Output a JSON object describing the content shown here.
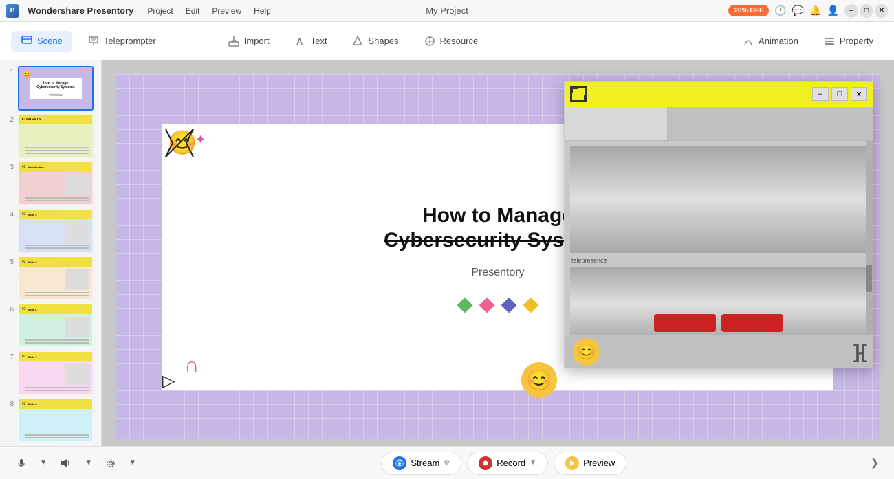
{
  "app": {
    "name": "Wondershare Presentory",
    "title": "My Project",
    "promo": "20% OFF"
  },
  "menu": {
    "items": [
      "Project",
      "Edit",
      "Preview",
      "Help"
    ]
  },
  "toolbar": {
    "items": [
      {
        "id": "scene",
        "label": "Scene",
        "icon": "scene-icon"
      },
      {
        "id": "teleprompter",
        "label": "Teleprompter",
        "icon": "teleprompter-icon"
      },
      {
        "id": "import",
        "label": "Import",
        "icon": "import-icon"
      },
      {
        "id": "text",
        "label": "Text",
        "icon": "text-icon"
      },
      {
        "id": "shapes",
        "label": "Shapes",
        "icon": "shapes-icon"
      },
      {
        "id": "resource",
        "label": "Resource",
        "icon": "resource-icon"
      }
    ],
    "right_items": [
      {
        "id": "animation",
        "label": "Animation",
        "icon": "animation-icon"
      },
      {
        "id": "property",
        "label": "Property",
        "icon": "property-icon"
      }
    ]
  },
  "slides": [
    {
      "num": 1,
      "active": true,
      "label": "How to Manage Cybersecurity Systems"
    },
    {
      "num": 2,
      "active": false,
      "label": "Contents"
    },
    {
      "num": 3,
      "active": false,
      "label": "Introduction"
    },
    {
      "num": 4,
      "active": false,
      "label": "Slide 4"
    },
    {
      "num": 5,
      "active": false,
      "label": "Slide 5"
    },
    {
      "num": 6,
      "active": false,
      "label": "Slide 6"
    },
    {
      "num": 7,
      "active": false,
      "label": "Slide 7"
    },
    {
      "num": 8,
      "active": false,
      "label": "Slide 8"
    }
  ],
  "main_slide": {
    "title_line1": "How to Manage",
    "title_line2": "Cybersecurity Systems",
    "subtitle": "Presentory"
  },
  "floating_window": {
    "title": "",
    "label": "telepresence"
  },
  "bottom_bar": {
    "stream_label": "Stream",
    "record_label": "Record",
    "preview_label": "Preview"
  },
  "window_controls": {
    "minimize": "–",
    "maximize": "□",
    "close": "✕"
  },
  "float_controls": {
    "minimize": "–",
    "maximize": "□",
    "close": "✕"
  }
}
